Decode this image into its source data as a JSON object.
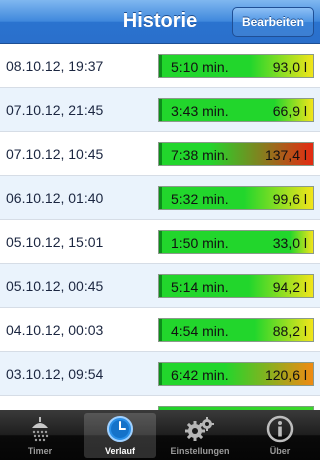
{
  "header": {
    "title": "Historie",
    "edit_label": "Bearbeiten"
  },
  "colors": {
    "green": "#22d62c",
    "yellow": "#f2e51a",
    "orange": "#f08a12",
    "red": "#e52a12"
  },
  "history": [
    {
      "date": "08.10.12, 19:37",
      "duration": "5:10 min.",
      "volume": "93,0 l"
    },
    {
      "date": "07.10.12, 21:45",
      "duration": "3:43 min.",
      "volume": "66,9 l"
    },
    {
      "date": "07.10.12, 10:45",
      "duration": "7:38 min.",
      "volume": "137,4 l"
    },
    {
      "date": "06.10.12, 01:40",
      "duration": "5:32 min.",
      "volume": "99,6 l"
    },
    {
      "date": "05.10.12, 15:01",
      "duration": "1:50 min.",
      "volume": "33,0 l"
    },
    {
      "date": "05.10.12, 00:45",
      "duration": "5:14 min.",
      "volume": "94,2 l"
    },
    {
      "date": "04.10.12, 00:03",
      "duration": "4:54 min.",
      "volume": "88,2 l"
    },
    {
      "date": "03.10.12, 09:54",
      "duration": "6:42 min.",
      "volume": "120,6 l"
    }
  ],
  "tabs": [
    {
      "label": "Timer",
      "icon": "shower-icon",
      "selected": false
    },
    {
      "label": "Verlauf",
      "icon": "clock-icon",
      "selected": true
    },
    {
      "label": "Einstellungen",
      "icon": "gears-icon",
      "selected": false
    },
    {
      "label": "Über",
      "icon": "info-icon",
      "selected": false
    }
  ]
}
